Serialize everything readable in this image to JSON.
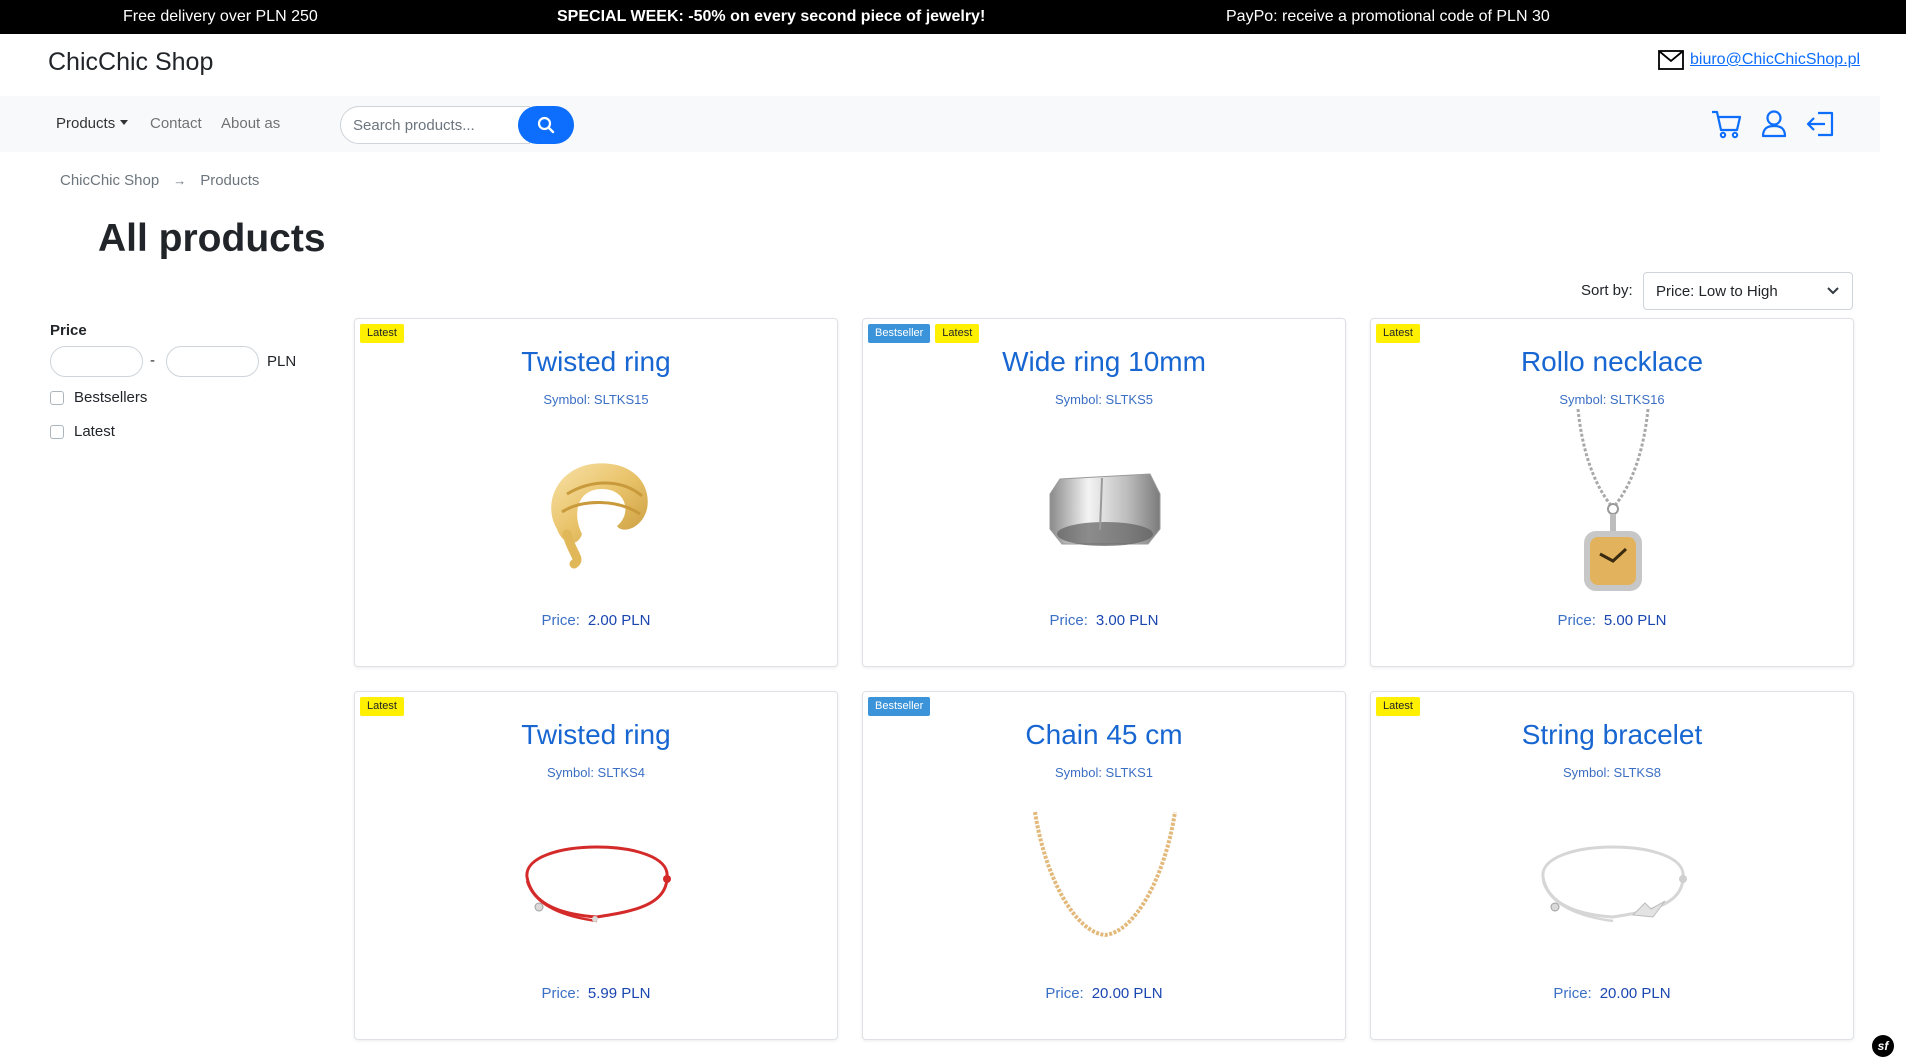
{
  "promo": {
    "left": "Free delivery over PLN 250",
    "center": "SPECIAL WEEK: -50% on every second piece of jewelry!",
    "right": "PayPo: receive a promotional code of PLN 30"
  },
  "header": {
    "brand": "ChicChic Shop",
    "email": "biuro@ChicChicShop.pl"
  },
  "nav": {
    "products": "Products",
    "contact": "Contact",
    "about": "About as",
    "search_placeholder": "Search products..."
  },
  "breadcrumb": {
    "home": "ChicChic Shop",
    "current": "Products"
  },
  "page_title": "All products",
  "sort": {
    "label": "Sort by:",
    "selected": "Price: Low to High"
  },
  "filters": {
    "price_title": "Price",
    "dash": "-",
    "currency": "PLN",
    "bestsellers": "Bestsellers",
    "latest": "Latest"
  },
  "product_labels": {
    "price": "Price:"
  },
  "products": [
    {
      "name": "Twisted ring",
      "symbol": "Symbol: SLTKS15",
      "price": "2.00 PLN",
      "badges": [
        "Latest"
      ],
      "image": "gold-ring"
    },
    {
      "name": "Wide ring 10mm",
      "symbol": "Symbol: SLTKS5",
      "price": "3.00 PLN",
      "badges": [
        "Bestseller",
        "Latest"
      ],
      "image": "silver-ring"
    },
    {
      "name": "Rollo necklace",
      "symbol": "Symbol: SLTKS16",
      "price": "5.00 PLN",
      "badges": [
        "Latest"
      ],
      "image": "pendant-necklace"
    },
    {
      "name": "Twisted ring",
      "symbol": "Symbol: SLTKS4",
      "price": "5.99 PLN",
      "badges": [
        "Latest"
      ],
      "image": "red-string-bracelet"
    },
    {
      "name": "Chain 45 cm",
      "symbol": "Symbol: SLTKS1",
      "price": "20.00 PLN",
      "badges": [
        "Bestseller"
      ],
      "image": "gold-chain"
    },
    {
      "name": "String bracelet",
      "symbol": "Symbol: SLTKS8",
      "price": "20.00 PLN",
      "badges": [
        "Latest"
      ],
      "image": "white-string-bracelet"
    }
  ],
  "colors": {
    "primary": "#0d6efd",
    "title_blue": "#1766d1",
    "badge_latest": "#ffef00",
    "badge_best": "#3b94d9"
  }
}
